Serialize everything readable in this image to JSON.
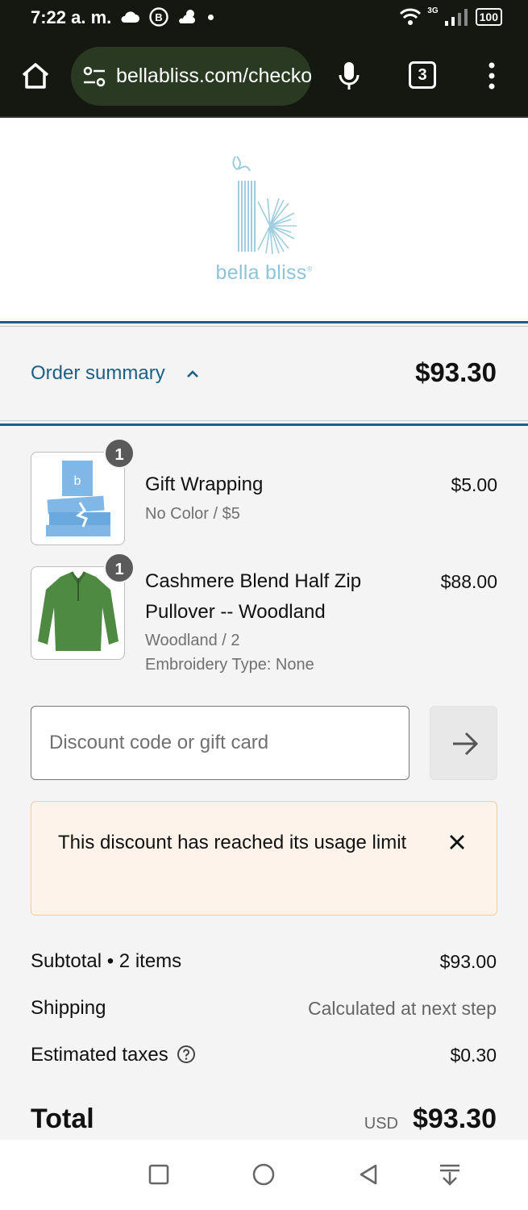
{
  "status_bar": {
    "time": "7:22 a. m.",
    "network": "3G",
    "battery": "100",
    "icons": [
      "cloud-icon",
      "b-app-icon",
      "weather-icon",
      "notification-dot",
      "wifi-icon",
      "signal-icon",
      "battery-icon"
    ]
  },
  "browser": {
    "url": "bellabliss.com/checkout",
    "tab_count": "3",
    "icons": [
      "home-icon",
      "site-settings-icon",
      "mic-icon",
      "tabs-icon",
      "more-vert-icon"
    ]
  },
  "brand": {
    "name": "bella bliss",
    "mark": "®",
    "logo_color": "#8ec4d8"
  },
  "summary": {
    "label": "Order summary",
    "total": "$93.30",
    "accent_color": "#1b5f88"
  },
  "items": [
    {
      "name": "Gift Wrapping",
      "variant": "No Color / $5",
      "price": "$5.00",
      "quantity": "1"
    },
    {
      "name": "Cashmere Blend Half Zip Pullover -- Woodland",
      "variant": "Woodland / 2",
      "extra": "Embroidery Type: None",
      "price": "$88.00",
      "quantity": "1"
    }
  ],
  "discount": {
    "placeholder": "Discount code or gift card",
    "error": "This discount has reached its usage limit"
  },
  "totals": {
    "subtotal_label": "Subtotal • 2 items",
    "subtotal_value": "$93.00",
    "shipping_label": "Shipping",
    "shipping_value": "Calculated at next step",
    "taxes_label": "Estimated taxes",
    "taxes_value": "$0.30",
    "total_label": "Total",
    "currency": "USD",
    "total_value": "$93.30"
  },
  "nav": {
    "icons": [
      "recent-apps-icon",
      "home-circle-icon",
      "back-icon",
      "collapse-icon"
    ]
  }
}
